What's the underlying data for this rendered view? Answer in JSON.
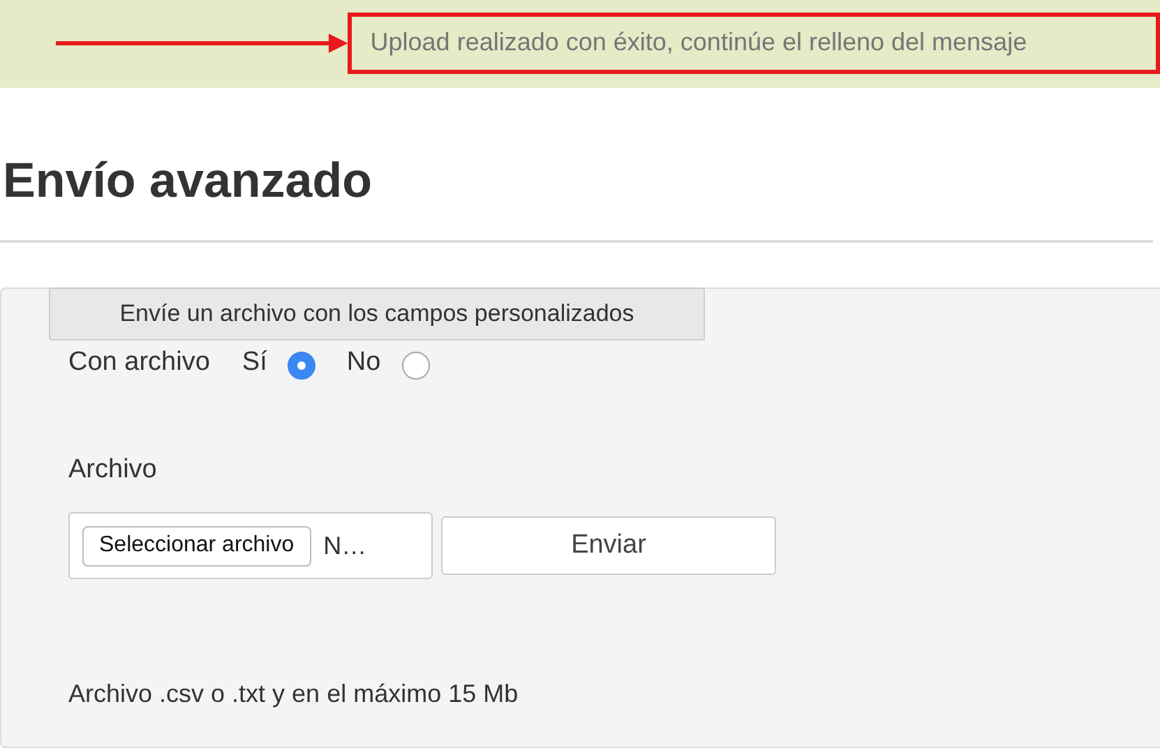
{
  "banner": {
    "message": "Upload realizado con éxito, continúe el relleno del mensaje"
  },
  "heading": "Envío avanzado",
  "form": {
    "legend": "Envíe un archivo con los campos personalizados",
    "radio_group": {
      "label": "Con archivo",
      "options": [
        {
          "label": "Sí",
          "selected": true
        },
        {
          "label": "No",
          "selected": false
        }
      ]
    },
    "file_label": "Archivo",
    "file_button": "Seleccionar archivo",
    "file_name": "N…",
    "submit": "Enviar",
    "note": "Archivo .csv o .txt y en el máximo 15 Mb"
  }
}
